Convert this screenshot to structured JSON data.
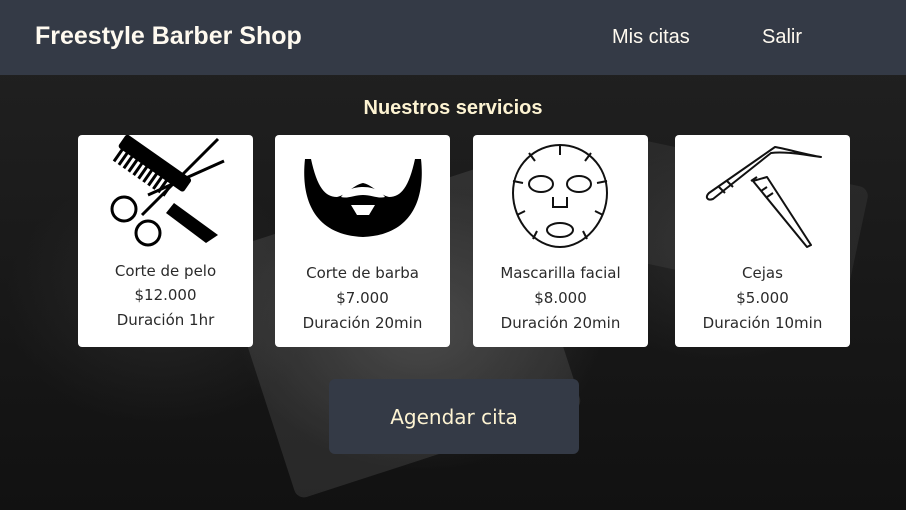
{
  "header": {
    "brand": "Freestyle Barber Shop",
    "nav": [
      {
        "label": "Mis citas"
      },
      {
        "label": "Salir"
      }
    ]
  },
  "main": {
    "title": "Nuestros servicios",
    "services": [
      {
        "name": "Corte de pelo",
        "price": "$12.000",
        "duration": "Duración 1hr",
        "icon": "scissors-comb-icon"
      },
      {
        "name": "Corte de barba",
        "price": "$7.000",
        "duration": "Duración 20min",
        "icon": "beard-icon"
      },
      {
        "name": "Mascarilla facial",
        "price": "$8.000",
        "duration": "Duración 20min",
        "icon": "face-mask-icon"
      },
      {
        "name": "Cejas",
        "price": "$5.000",
        "duration": "Duración 10min",
        "icon": "tweezers-icon"
      }
    ],
    "cta_label": "Agendar cita"
  },
  "colors": {
    "header_bg": "#343a46",
    "accent_text": "#fdf3d2",
    "card_bg": "#ffffff"
  }
}
